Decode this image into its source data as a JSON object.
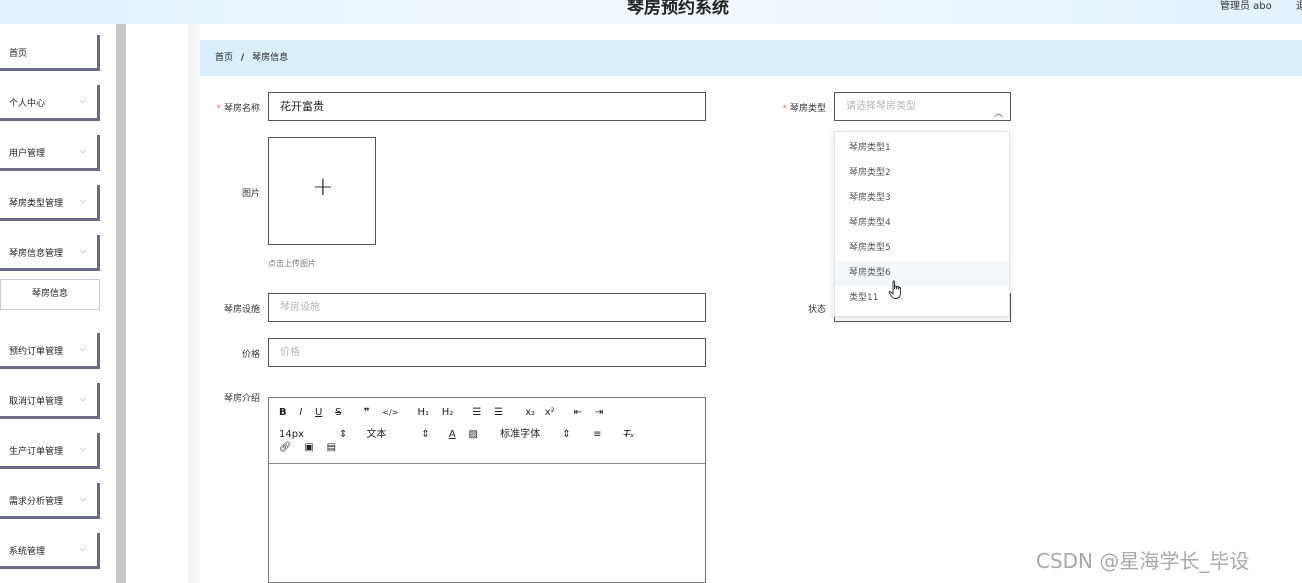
{
  "header": {
    "title": "琴房预约系统",
    "user": "管理员 abo",
    "logout": "退"
  },
  "sidebar": {
    "items": [
      {
        "label": "首页",
        "has_children": false
      },
      {
        "label": "个人中心",
        "has_children": true
      },
      {
        "label": "用户管理",
        "has_children": true
      },
      {
        "label": "琴房类型管理",
        "has_children": true
      },
      {
        "label": "琴房信息管理",
        "has_children": true
      },
      {
        "label": "预约订单管理",
        "has_children": true
      },
      {
        "label": "取消订单管理",
        "has_children": true
      },
      {
        "label": "生产订单管理",
        "has_children": true
      },
      {
        "label": "需求分析管理",
        "has_children": true
      },
      {
        "label": "系统管理",
        "has_children": true
      }
    ],
    "active_sub": "琴房信息",
    "chevron": "⌵"
  },
  "breadcrumb": {
    "home": "首页",
    "separator": "/",
    "current": "琴房信息"
  },
  "form": {
    "required_mark": "*",
    "name": {
      "label": "琴房名称",
      "value": "花开富贵"
    },
    "type": {
      "label": "琴房类型",
      "placeholder": "请选择琴房类型"
    },
    "image": {
      "label": "图片",
      "hint": "点击上传图片"
    },
    "facilities": {
      "label": "琴房设施",
      "placeholder": "琴房设施"
    },
    "status": {
      "label": "状态"
    },
    "price": {
      "label": "价格",
      "placeholder": "价格"
    },
    "intro": {
      "label": "琴房介绍"
    }
  },
  "editor": {
    "font_size": "14px",
    "text_style": "文本",
    "font_family": "标准字体"
  },
  "dropdown": {
    "options": [
      "琴房类型1",
      "琴房类型2",
      "琴房类型3",
      "琴房类型4",
      "琴房类型5",
      "琴房类型6",
      "类型11"
    ],
    "hovered_index": 5
  },
  "watermark": "CSDN @星海学长_毕设"
}
